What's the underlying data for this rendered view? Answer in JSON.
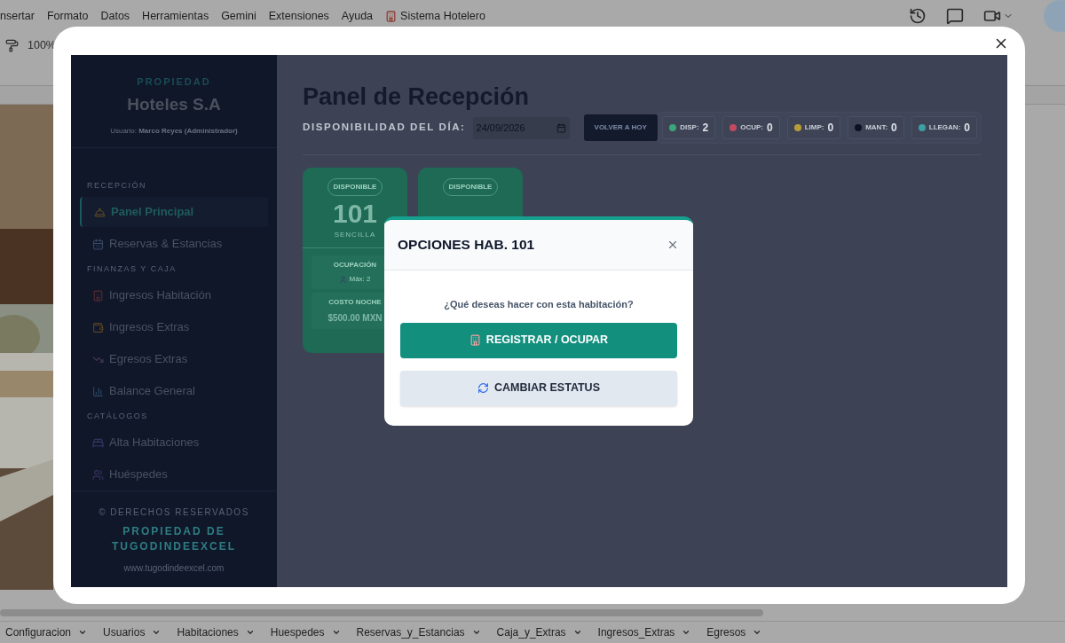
{
  "menu_bar": {
    "items": [
      "nsertar",
      "Formato",
      "Datos",
      "Herramientas",
      "Gemini",
      "Extensiones",
      "Ayuda"
    ],
    "addon": "Sistema Hotelero"
  },
  "toolbar": {
    "zoom": "100%"
  },
  "app": {
    "sidebar": {
      "eyebrow": "PROPIEDAD",
      "property": "Hoteles S.A",
      "user": "Usuario: **Marco Reyes (Administrador)**",
      "sections": [
        {
          "label": "RECEPCIÓN",
          "items": [
            {
              "label": "Panel Principal",
              "selected": true
            },
            {
              "label": "Reservas & Estancias",
              "selected": false
            }
          ]
        },
        {
          "label": "FINANZAS Y CAJA",
          "items": [
            {
              "label": "Ingresos Habitación",
              "selected": false
            },
            {
              "label": "Ingresos Extras",
              "selected": false
            },
            {
              "label": "Egresos Extras",
              "selected": false
            },
            {
              "label": "Balance General",
              "selected": false
            }
          ]
        },
        {
          "label": "CATÁLOGOS",
          "items": [
            {
              "label": "Alta Habitaciones",
              "selected": false
            },
            {
              "label": "Huéspedes",
              "selected": false
            }
          ]
        }
      ],
      "footer": {
        "copyright": "© DERECHOS RESERVADOS",
        "owner": "PROPIEDAD DE TUGODINDEEXCEL",
        "website": "www.tugodindeexcel.com"
      }
    },
    "header": {
      "title": "Panel de Recepción",
      "date_label": "DISPONIBILIDAD DEL DÍA:",
      "date_value": "24/09/2026",
      "today_button": "VOLVER A HOY"
    },
    "stats": [
      {
        "label": "DISP:",
        "value": "2",
        "color": "#3aa57a"
      },
      {
        "label": "OCUP:",
        "value": "0",
        "color": "#c24a5e"
      },
      {
        "label": "LIMP:",
        "value": "0",
        "color": "#b89c3a"
      },
      {
        "label": "MANT:",
        "value": "0",
        "color": "#0d1220"
      },
      {
        "label": "LLEGAN:",
        "value": "0",
        "color": "#3aa0a4"
      }
    ],
    "rooms": [
      {
        "status": "DISPONIBLE",
        "number": "101",
        "type": "SENCILLA",
        "occupancy_label": "OCUPACIÓN",
        "occupancy": "Máx: 2",
        "price_label": "COSTO NOCHE",
        "price": "$500.00 MXN"
      },
      {
        "status": "DISPONIBLE"
      }
    ]
  },
  "modal": {
    "title": "OPCIONES HAB. 101",
    "prompt": "¿Qué deseas hacer con esta habitación?",
    "actions": [
      {
        "label": "REGISTRAR / OCUPAR",
        "kind": "primary"
      },
      {
        "label": "CAMBIAR ESTATUS",
        "kind": "secondary"
      }
    ]
  },
  "sheet_tabs": [
    "Configuracion",
    "Usuarios",
    "Habitaciones",
    "Huespedes",
    "Reservas_y_Estancias",
    "Caja_y_Extras",
    "Ingresos_Extras",
    "Egresos"
  ]
}
